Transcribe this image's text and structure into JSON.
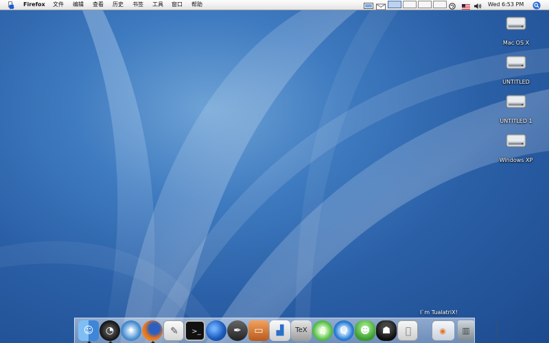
{
  "menubar": {
    "apple": "",
    "app_name": "Firefox",
    "items": [
      {
        "label": "文件"
      },
      {
        "label": "编辑"
      },
      {
        "label": "查看"
      },
      {
        "label": "历史"
      },
      {
        "label": "书签"
      },
      {
        "label": "工具"
      },
      {
        "label": "窗口"
      },
      {
        "label": "帮助"
      }
    ],
    "clock": "Wed 6:53 PM",
    "status_icons": [
      "display-icon",
      "mail-icon",
      "spaces-boxes",
      "sync-icon",
      "flag-icon",
      "volume-icon",
      "spotlight-icon"
    ]
  },
  "desktop": {
    "icons": [
      {
        "label": "Mac OS X",
        "icon": "hard-drive-icon"
      },
      {
        "label": "UNTITLED",
        "icon": "hard-drive-icon"
      },
      {
        "label": "UNTITLED 1",
        "icon": "hard-drive-icon"
      },
      {
        "label": "Windows XP",
        "icon": "hard-drive-icon"
      }
    ]
  },
  "dock": {
    "tooltip": "I`m TualatriX!",
    "apps": [
      {
        "name": "finder",
        "color": "#5aa0e8",
        "running": true
      },
      {
        "name": "dashboard",
        "color": "#2a2a2a",
        "running": true
      },
      {
        "name": "safari",
        "color": "#4a8fd0",
        "running": false
      },
      {
        "name": "firefox",
        "color": "#e8731a",
        "running": true
      },
      {
        "name": "textedit",
        "color": "#ececec",
        "running": false
      },
      {
        "name": "terminal",
        "color": "#1a1a1a",
        "running": false
      },
      {
        "name": "google-earth",
        "color": "#1f5fbf",
        "running": false
      },
      {
        "name": "inkscape",
        "color": "#333333",
        "running": false
      },
      {
        "name": "keynote",
        "color": "#c96a2a",
        "running": false
      },
      {
        "name": "grapher",
        "color": "#d8d8d8",
        "running": false
      },
      {
        "name": "latex",
        "color": "#b8b8b8",
        "running": false
      },
      {
        "name": "itunes",
        "color": "#5ac14a",
        "running": false
      },
      {
        "name": "quicktime",
        "color": "#2b7fd6",
        "running": false
      },
      {
        "name": "adium",
        "color": "#3c9a2e",
        "running": false
      },
      {
        "name": "spy",
        "color": "#1e1e1e",
        "running": false
      },
      {
        "name": "about-this-mac",
        "color": "#dcdcdc",
        "running": false
      }
    ],
    "right": [
      {
        "name": "firefox-window",
        "color": "#e0e6ef"
      },
      {
        "name": "trash",
        "color": "#9aa3ab"
      }
    ]
  }
}
